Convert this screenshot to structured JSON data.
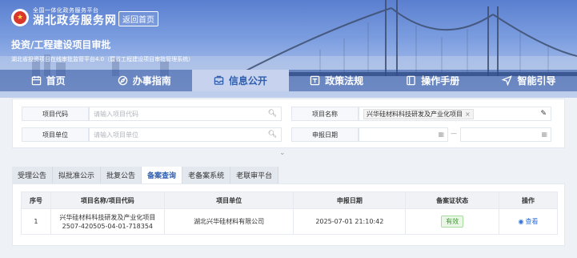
{
  "header": {
    "logo_small": "全国一体化政务服务平台",
    "logo_big": "湖北政务服务网",
    "back_label": "返回首页",
    "title": "投资/工程建设项目审批",
    "subtitle": "湖北省投资项目在线审批监管平台4.0（暨省工程建设项目审批管理系统）"
  },
  "nav": {
    "items": [
      {
        "label": "首页",
        "icon": "calendar-icon"
      },
      {
        "label": "办事指南",
        "icon": "compass-icon"
      },
      {
        "label": "信息公开",
        "icon": "inbox-icon"
      },
      {
        "label": "政策法规",
        "icon": "law-icon"
      },
      {
        "label": "操作手册",
        "icon": "book-icon"
      },
      {
        "label": "智能引导",
        "icon": "navigate-icon"
      }
    ],
    "active": "信息公开"
  },
  "search": {
    "project_code_label": "项目代码",
    "project_code_placeholder": "请输入项目代码",
    "project_name_label": "项目名称",
    "project_name_value": "兴华硅材料科技研发及产业化项目",
    "project_unit_label": "项目单位",
    "project_unit_placeholder": "请输入项目单位",
    "report_date_label": "申报日期",
    "date_separator": "—"
  },
  "tabs": [
    "受理公告",
    "拟批准公示",
    "批复公告",
    "备案查询",
    "老备案系统",
    "老联审平台"
  ],
  "active_tab": "备案查询",
  "table": {
    "headers": [
      "序号",
      "项目名称/项目代码",
      "项目单位",
      "申报日期",
      "备案证状态",
      "操作"
    ],
    "rows": [
      {
        "index": "1",
        "name": "兴华硅材料科技研发及产业化项目",
        "code": "2507-420505-04-01-718354",
        "unit": "湖北兴华硅材料有限公司",
        "date": "2025-07-01 21:10:42",
        "status": "有效",
        "action": "查看"
      }
    ]
  },
  "colors": {
    "accent": "#2f5eaf",
    "status_green": "#3a9a2e",
    "link": "#2f6fd6"
  }
}
